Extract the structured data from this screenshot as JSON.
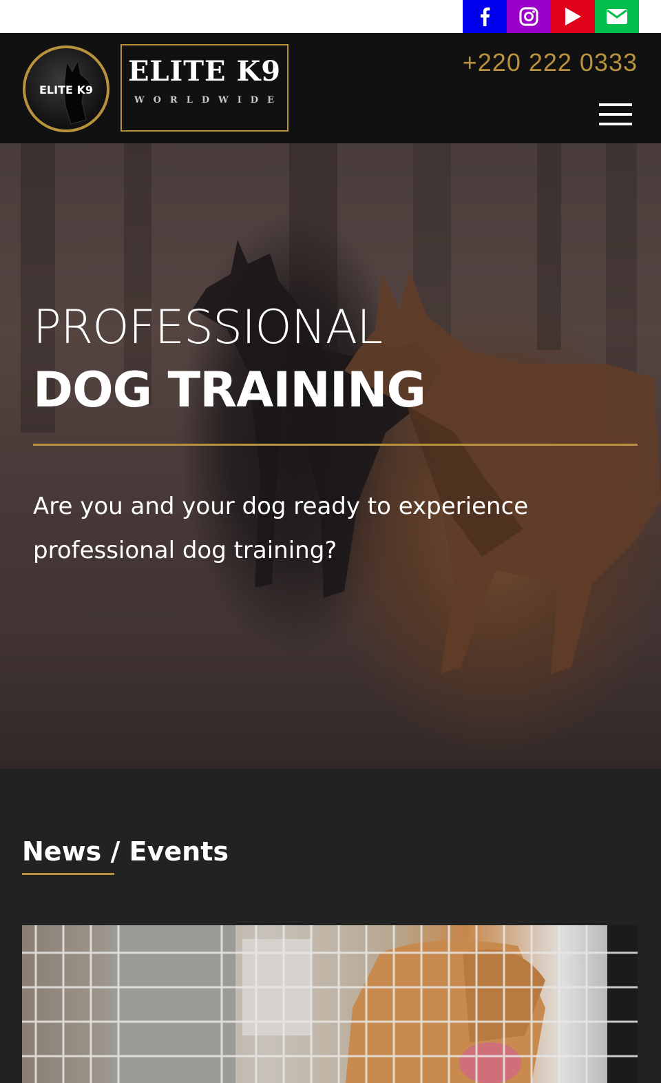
{
  "social": {
    "items": [
      {
        "name": "facebook",
        "icon": "facebook-icon",
        "color": "#0000ee"
      },
      {
        "name": "instagram",
        "icon": "instagram-icon",
        "color": "#9b00c9"
      },
      {
        "name": "youtube",
        "icon": "youtube-icon",
        "color": "#e0001a"
      },
      {
        "name": "email",
        "icon": "email-icon",
        "color": "#00c04b"
      }
    ]
  },
  "header": {
    "logo_circle_text": "ELITE K9",
    "brand": "ELITE K9",
    "brand_sub": "WORLDWIDE",
    "phone": "+220 222 0333",
    "menu_icon": "hamburger-icon",
    "accent_color": "#b8923d"
  },
  "hero": {
    "line1": "PROFESSIONAL",
    "line2": "DOG TRAINING",
    "text": "Are you and your dog ready to experience professional dog training?"
  },
  "news": {
    "title": "News / Events"
  }
}
